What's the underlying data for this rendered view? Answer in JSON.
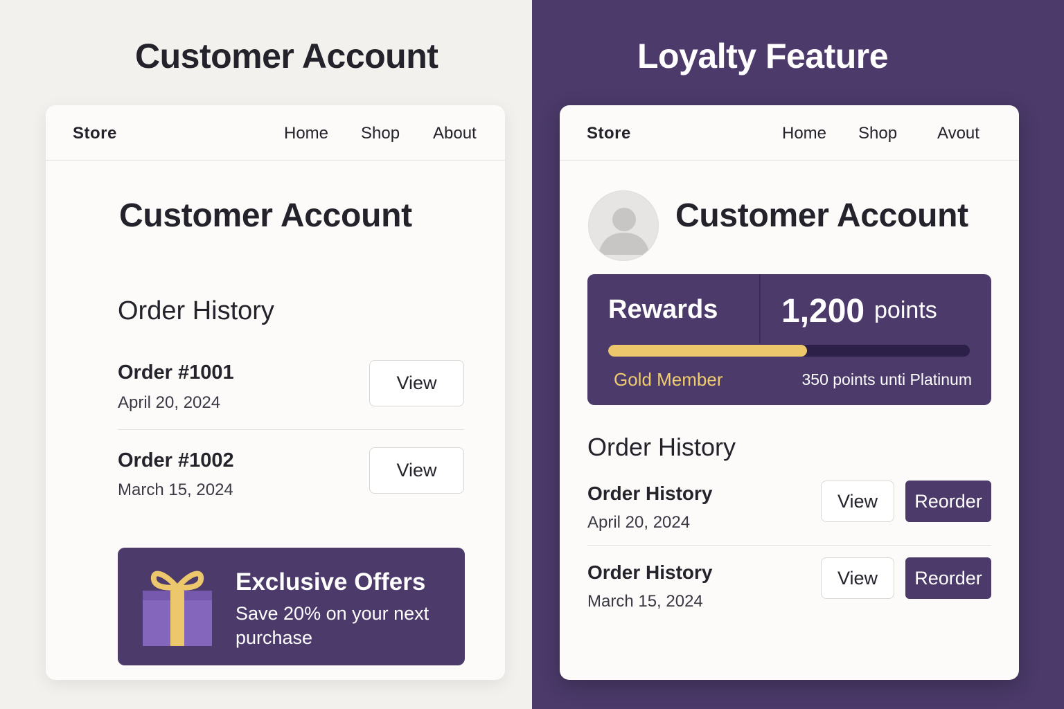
{
  "left_panel": {
    "heading": "Customer Account",
    "nav": {
      "brand": "Store",
      "links": [
        "Home",
        "Shop",
        "About"
      ]
    },
    "account_title": "Customer Account",
    "order_history_title": "Order History",
    "orders": [
      {
        "name": "Order #1001",
        "date": "April 20, 2024",
        "view_label": "View"
      },
      {
        "name": "Order #1002",
        "date": "March 15, 2024",
        "view_label": "View"
      }
    ],
    "offer": {
      "icon": "gift-icon",
      "title": "Exclusive Offers",
      "text": "Save 20% on your next purchase"
    }
  },
  "right_panel": {
    "heading": "Loyalty Feature",
    "nav": {
      "brand": "Store",
      "links": [
        "Home",
        "Shop",
        "Avout"
      ]
    },
    "avatar_icon": "user-avatar-icon",
    "account_title": "Customer Account",
    "rewards": {
      "label": "Rewards",
      "points": "1,200",
      "points_unit": "points",
      "progress_fraction": 0.55,
      "tier": "Gold Member",
      "next_tier_text": "350 points unti Platinum"
    },
    "order_history_title": "Order History",
    "orders": [
      {
        "name": "Order History",
        "date": "April 20, 2024",
        "view_label": "View",
        "reorder_label": "Reorder"
      },
      {
        "name": "Order History",
        "date": "March 15, 2024",
        "view_label": "View",
        "reorder_label": "Reorder"
      }
    ]
  },
  "colors": {
    "brand_purple": "#4b3a6a",
    "gold": "#edc76c",
    "left_background": "#f3f1ee",
    "card_background": "#fcfbf9"
  }
}
